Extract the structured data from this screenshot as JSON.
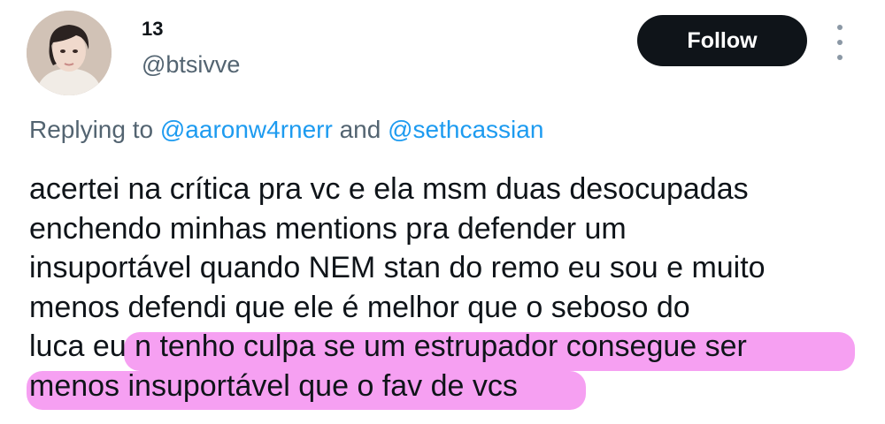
{
  "user": {
    "display_name": "13",
    "handle": "@btsivve",
    "avatar_icon": "profile-photo"
  },
  "follow_label": "Follow",
  "more_icon": "three-dots-vertical-icon",
  "reply": {
    "prefix": "Replying to",
    "mention1": "@aaronw4rnerr",
    "conjunction": "and",
    "mention2": "@sethcassian"
  },
  "tweet_lines": [
    "acertei na crítica pra vc e ela msm duas desocupadas",
    "enchendo minhas mentions pra defender um",
    "insuportável quando NEM stan do remo eu sou e muito",
    "menos defendi que ele é melhor que o seboso do",
    "luca eu n tenho culpa se um estrupador consegue ser",
    "menos insuportável que o fav de vcs"
  ],
  "colors": {
    "highlight": "#f58ff0",
    "mention": "#1d9bf0",
    "button": "#0f1419"
  }
}
